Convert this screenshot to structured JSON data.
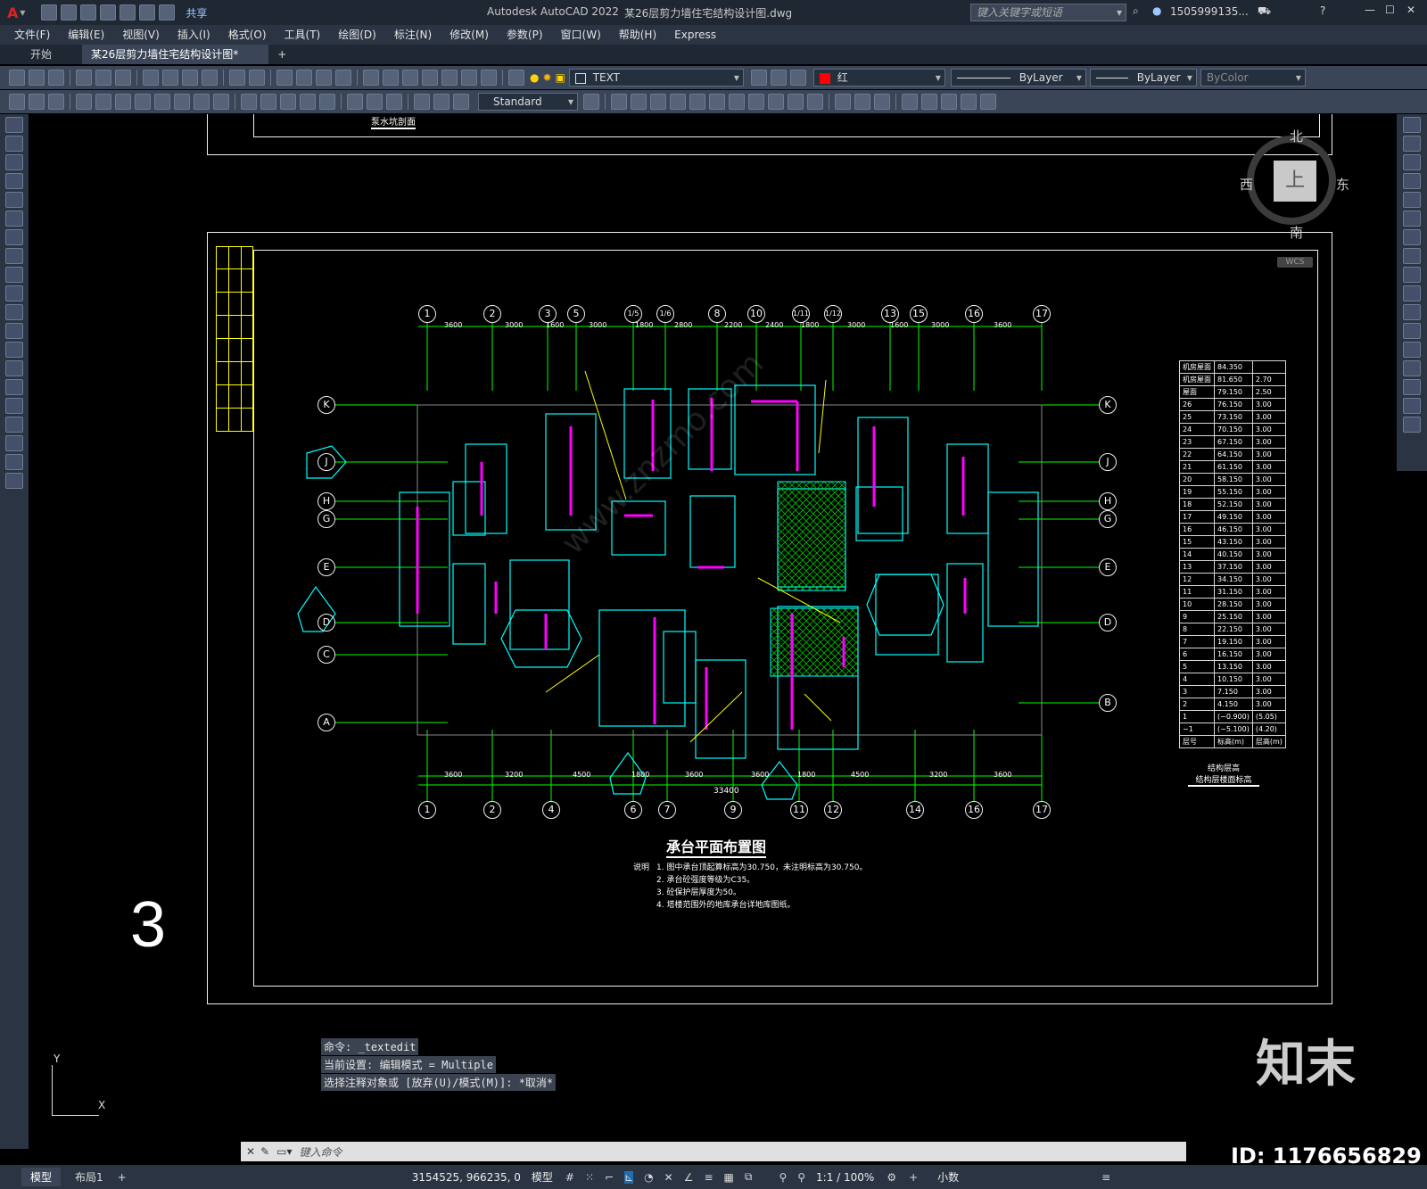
{
  "app": {
    "title": "Autodesk AutoCAD 2022",
    "file": "某26层剪力墙住宅结构设计图.dwg",
    "search_placeholder": "键入关键字或短语",
    "user": "1505999135...",
    "share": "共享"
  },
  "menu": [
    "文件(F)",
    "编辑(E)",
    "视图(V)",
    "插入(I)",
    "格式(O)",
    "工具(T)",
    "绘图(D)",
    "标注(N)",
    "修改(M)",
    "参数(P)",
    "窗口(W)",
    "帮助(H)",
    "Express"
  ],
  "tabs": {
    "start": "开始",
    "active": "某26层剪力墙住宅结构设计图*",
    "add": "+"
  },
  "props": {
    "layer": "TEXT",
    "color": "红",
    "linetype": "ByLayer",
    "lineweight": "ByLayer",
    "plotstyle": "ByColor",
    "textstyle": "Standard"
  },
  "viewcube": {
    "north": "北",
    "south": "南",
    "east": "东",
    "west": "西",
    "top": "上",
    "wcs": "WCS"
  },
  "drawing": {
    "top_caption": "泵水坑剖面",
    "plan_title": "承台平面布置图",
    "sheet_number": "3",
    "notes_label": "说明",
    "notes": [
      "1. 图中承台顶起算标高为30.750，未注明标高为30.750。",
      "2. 承台砼强度等级为C35。",
      "3. 砼保护层厚度为50。",
      "4. 塔楼范围外的地库承台详地库图纸。"
    ],
    "axis_top": [
      "1",
      "2",
      "3",
      "5",
      "1/5",
      "1/6",
      "8",
      "10",
      "1/11",
      "1/12",
      "13",
      "15",
      "16",
      "17"
    ],
    "axis_bottom": [
      "1",
      "2",
      "4",
      "6",
      "7",
      "9",
      "11",
      "12",
      "14",
      "16",
      "17"
    ],
    "axis_rows": [
      "K",
      "J",
      "H",
      "G",
      "E",
      "D",
      "C",
      "A"
    ],
    "axis_rows_right": [
      "K",
      "J",
      "H",
      "G",
      "E",
      "D",
      "B"
    ],
    "dims_top": [
      "3600",
      "3000",
      "1600",
      "3000",
      "1800",
      "2800",
      "2200",
      "2400",
      "1800",
      "3000",
      "1600",
      "3000",
      "3600"
    ],
    "dims_bottom": [
      "3600",
      "3200",
      "4500",
      "1800",
      "3600",
      "3600",
      "1800",
      "4500",
      "3200",
      "3600"
    ],
    "total_dim": "33400",
    "table_rows": [
      [
        "机房屋面",
        "84.350",
        ""
      ],
      [
        "机房屋面",
        "81.650",
        "2.70"
      ],
      [
        "屋面",
        "79.150",
        "2.50"
      ],
      [
        "26",
        "76.150",
        "3.00"
      ],
      [
        "25",
        "73.150",
        "3.00"
      ],
      [
        "24",
        "70.150",
        "3.00"
      ],
      [
        "23",
        "67.150",
        "3.00"
      ],
      [
        "22",
        "64.150",
        "3.00"
      ],
      [
        "21",
        "61.150",
        "3.00"
      ],
      [
        "20",
        "58.150",
        "3.00"
      ],
      [
        "19",
        "55.150",
        "3.00"
      ],
      [
        "18",
        "52.150",
        "3.00"
      ],
      [
        "17",
        "49.150",
        "3.00"
      ],
      [
        "16",
        "46.150",
        "3.00"
      ],
      [
        "15",
        "43.150",
        "3.00"
      ],
      [
        "14",
        "40.150",
        "3.00"
      ],
      [
        "13",
        "37.150",
        "3.00"
      ],
      [
        "12",
        "34.150",
        "3.00"
      ],
      [
        "11",
        "31.150",
        "3.00"
      ],
      [
        "10",
        "28.150",
        "3.00"
      ],
      [
        "9",
        "25.150",
        "3.00"
      ],
      [
        "8",
        "22.150",
        "3.00"
      ],
      [
        "7",
        "19.150",
        "3.00"
      ],
      [
        "6",
        "16.150",
        "3.00"
      ],
      [
        "5",
        "13.150",
        "3.00"
      ],
      [
        "4",
        "10.150",
        "3.00"
      ],
      [
        "3",
        "7.150",
        "3.00"
      ],
      [
        "2",
        "4.150",
        "3.00"
      ],
      [
        "1",
        "(−0.900)",
        "(5.05)"
      ],
      [
        "−1",
        "(−5.100)",
        "(4.20)"
      ],
      [
        "层号",
        "标高(m)",
        "层高(m)"
      ]
    ],
    "table_caption1": "结构层高",
    "table_caption2": "结构层楼面标高"
  },
  "command": {
    "history": [
      "命令: _textedit",
      "当前设置: 编辑模式 = Multiple",
      "选择注释对象或 [放弃(U)/模式(M)]: *取消*"
    ],
    "placeholder": "键入命令"
  },
  "status": {
    "coords": "3154525, 966235, 0",
    "model_label": "模型",
    "scale": "1:1 / 100%",
    "units": "小数",
    "layout_tabs": [
      "模型",
      "布局1"
    ]
  },
  "watermark": {
    "brand": "知末",
    "id": "ID: 1176656829",
    "site": "www.znzmo.com"
  },
  "ucs": {
    "x": "X",
    "y": "Y"
  },
  "colors": {
    "bg": "#000000",
    "ui": "#2b3442",
    "axis": "#00ff00",
    "wall": "#ff00ff",
    "pile": "#00ffff",
    "label": "#ffff00"
  }
}
